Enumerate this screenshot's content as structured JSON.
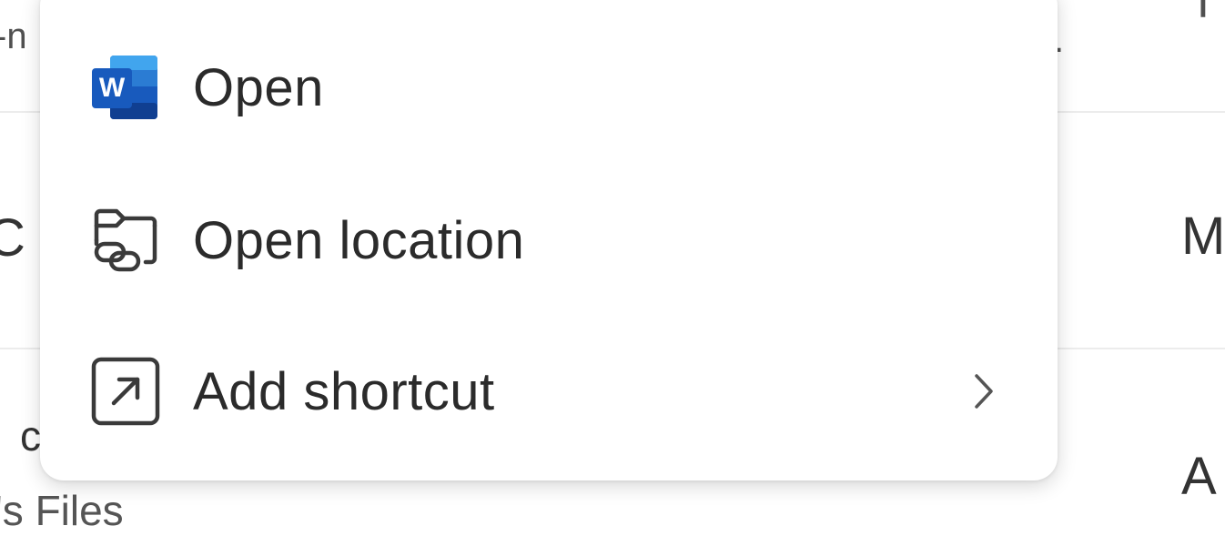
{
  "background": {
    "row1_left": "-n",
    "row1_dot": ".",
    "row1_right": "T",
    "row2_left": "C",
    "row2_right": "M",
    "row3_left": "c",
    "row3_subtitle": "'s Files",
    "row3_right": "A"
  },
  "context_menu": {
    "items": [
      {
        "label": "Open",
        "icon": "word-icon",
        "has_submenu": false
      },
      {
        "label": "Open location",
        "icon": "folder-link-icon",
        "has_submenu": false
      },
      {
        "label": "Add shortcut",
        "icon": "shortcut-arrow-icon",
        "has_submenu": true
      }
    ]
  },
  "colors": {
    "word_blue_dark": "#185abd",
    "word_blue_mid": "#2b7cd3",
    "word_blue_light": "#41a5ee",
    "text": "#2b2b2b",
    "icon_stroke": "#3a3a3a"
  }
}
